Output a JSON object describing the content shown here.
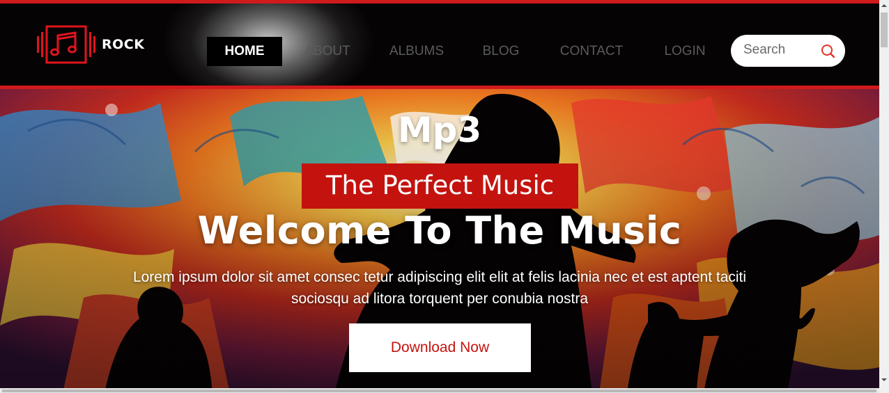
{
  "brand": {
    "name": "ROCK",
    "logo_icon": "music-note-icon",
    "accent": "#d11b1b"
  },
  "nav": {
    "items": [
      {
        "label": "HOME",
        "active": true
      },
      {
        "label": "ABOUT",
        "active": false
      },
      {
        "label": "ALBUMS",
        "active": false
      },
      {
        "label": "BLOG",
        "active": false
      },
      {
        "label": "CONTACT",
        "active": false
      },
      {
        "label": "LOGIN",
        "active": false
      }
    ]
  },
  "search": {
    "placeholder": "Search",
    "icon": "search-icon",
    "icon_color": "#e3302a"
  },
  "hero": {
    "kicker": "Mp3",
    "badge": "The Perfect Music",
    "title": "Welcome To The Music",
    "description": "Lorem ipsum dolor sit amet consec tetur adipiscing elit elit at felis lacinia nec et est aptent taciti sociosqu ad litora torquent per conubia nostra",
    "cta": "Download Now",
    "badge_color": "#c4130f"
  }
}
